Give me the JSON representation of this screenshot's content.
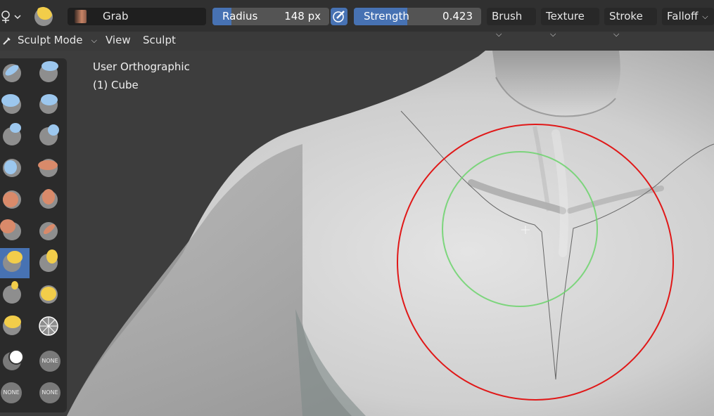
{
  "toolbar": {
    "brush_name": "Grab",
    "radius": {
      "label": "Radius",
      "value": "148 px",
      "fill_fraction": 0.16
    },
    "strength": {
      "label": "Strength",
      "value": "0.423",
      "fill_fraction": 0.42
    },
    "menus": [
      "Brush",
      "Texture",
      "Stroke",
      "Falloff"
    ]
  },
  "header": {
    "mode": "Sculpt Mode",
    "menu_view": "View",
    "menu_sculpt": "Sculpt"
  },
  "viewport": {
    "view_name": "User Orthographic",
    "object_name": "(1) Cube"
  },
  "tools": {
    "active_tool": "grab",
    "none_label": "NONE",
    "brush_colors": {
      "blue": "#9cc7ee",
      "orange": "#d98a6a",
      "yellow": "#f2cd4a",
      "white": "#ffffff"
    }
  },
  "cursor": {
    "outer_color": "#e01818",
    "inner_color": "#6cd36c"
  }
}
